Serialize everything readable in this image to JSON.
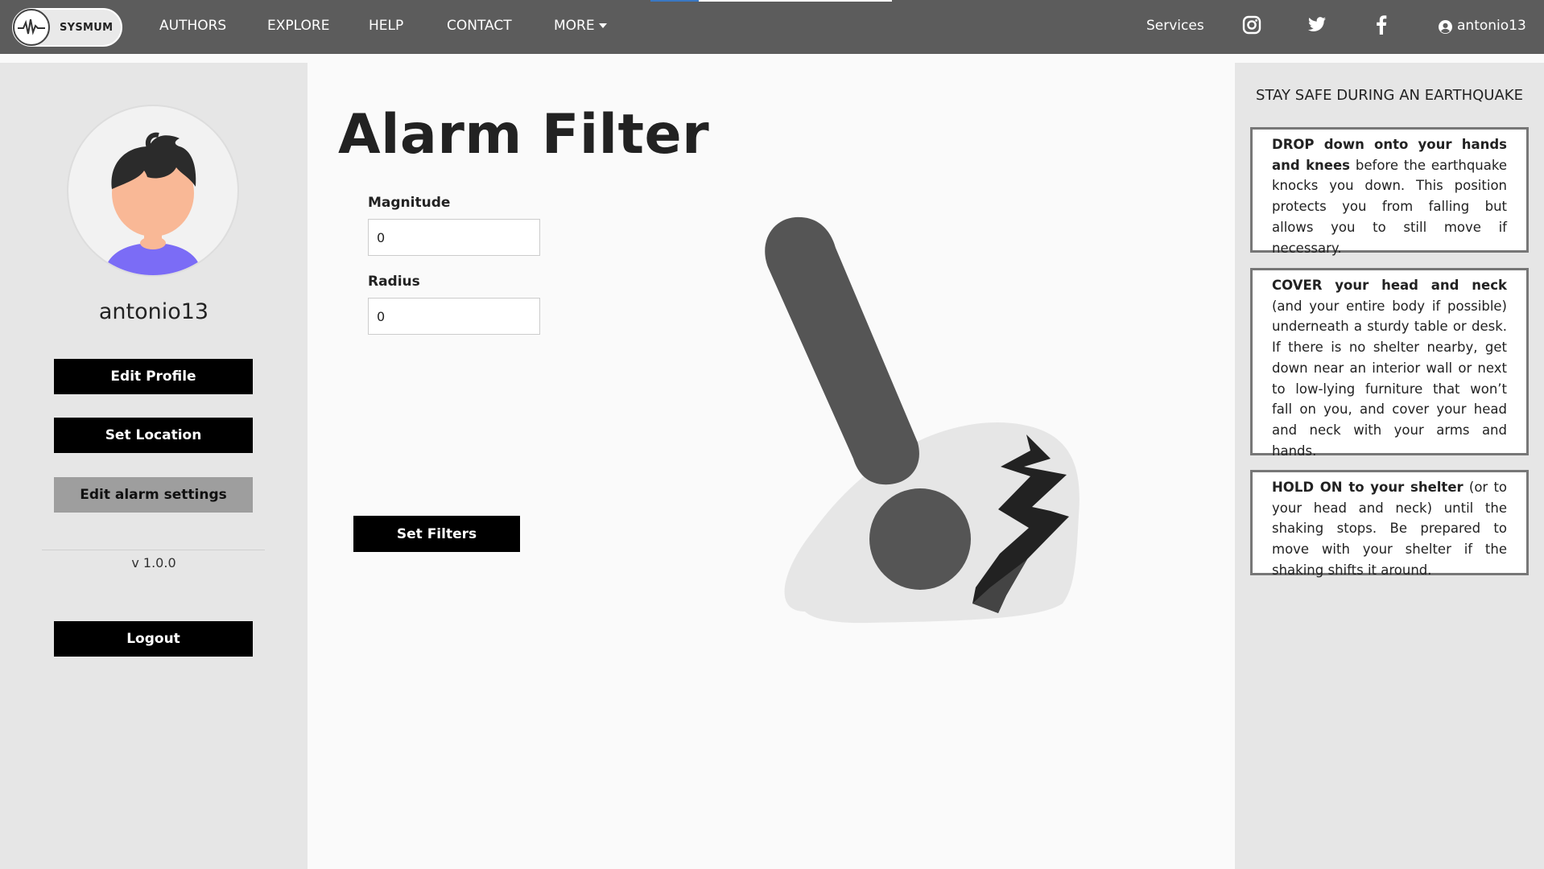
{
  "nav": {
    "logo_text": "SYSMUM",
    "items": [
      "AUTHORS",
      "EXPLORE",
      "HELP",
      "CONTACT",
      "MORE"
    ],
    "services": "Services",
    "user": "antonio13"
  },
  "sidebar": {
    "username": "antonio13",
    "edit_profile": "Edit Profile",
    "set_location": "Set Location",
    "edit_alarm": "Edit alarm settings",
    "version": "v 1.0.0",
    "logout": "Logout"
  },
  "main": {
    "title": "Alarm Filter",
    "magnitude_label": "Magnitude",
    "magnitude_value": "0",
    "radius_label": "Radius",
    "radius_value": "0",
    "set_filters": "Set Filters"
  },
  "tips": {
    "title": "STAY SAFE DURING AN EARTHQUAKE",
    "drop_bold": "DROP down onto your hands and knees",
    "drop_text": " before the earthquake knocks you down. This position protects you from falling but allows you to still move if necessary.",
    "cover_bold": "COVER your head and neck",
    "cover_text": " (and your entire body if possible) underneath a sturdy table or desk. If there is no shelter nearby, get down near an interior wall or next to low-lying furniture that won’t fall on you, and cover your head and neck with your arms and hands.",
    "hold_bold": "HOLD ON to your shelter",
    "hold_text": " (or to your head and neck) until the shaking stops. Be prepared to move with your shelter if the shaking shifts it around."
  },
  "colors": {
    "topbar": "#5c5c5c",
    "sidebar": "#e6e6e6",
    "button": "#000000",
    "button_active": "#9e9e9e",
    "avatar_shirt": "#7b6cf6",
    "avatar_skin": "#f9b896"
  },
  "icons": [
    "logo-icon",
    "caret-down-icon",
    "instagram-icon",
    "twitter-icon",
    "facebook-icon",
    "user-circle-icon"
  ]
}
